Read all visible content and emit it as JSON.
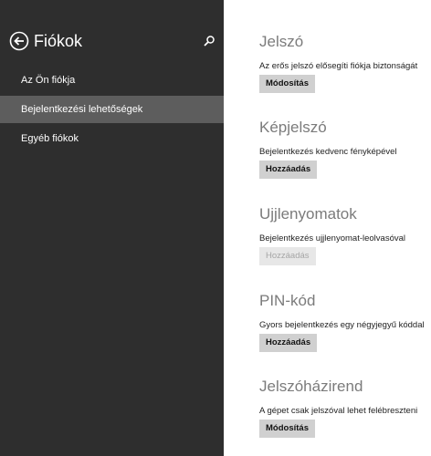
{
  "sidebar": {
    "title": "Fiókok",
    "back_icon": "back-arrow-circle-icon",
    "search_icon": "search-icon",
    "items": [
      {
        "label": "Az Ön fiókja"
      },
      {
        "label": "Bejelentkezési lehetőségek",
        "selected": true
      },
      {
        "label": "Egyéb fiókok"
      }
    ]
  },
  "main": {
    "sections": [
      {
        "title": "Jelszó",
        "description": "Az erős jelszó elősegíti fiókja biztonságát",
        "button": "Módosítás"
      },
      {
        "title": "Képjelszó",
        "description": "Bejelentkezés kedvenc fényképével",
        "button": "Hozzáadás"
      },
      {
        "title": "Ujjlenyomatok",
        "description": "Bejelentkezés ujjlenyomat-leolvasóval",
        "button": "Hozzáadás",
        "button_disabled": true
      },
      {
        "title": "PIN-kód",
        "description": "Gyors bejelentkezés egy négyjegyű kóddal",
        "button": "Hozzáadás"
      },
      {
        "title": "Jelszóházirend",
        "description": "A gépet csak jelszóval lehet felébreszteni",
        "button": "Módosítás"
      }
    ]
  },
  "colors": {
    "sidebar_bg": "#2e2e2e",
    "sidebar_selected": "#5d5d5d",
    "section_title": "#7b7b7b",
    "button_bg": "#d0d0d0",
    "button_disabled_bg": "#e7e7e7"
  }
}
